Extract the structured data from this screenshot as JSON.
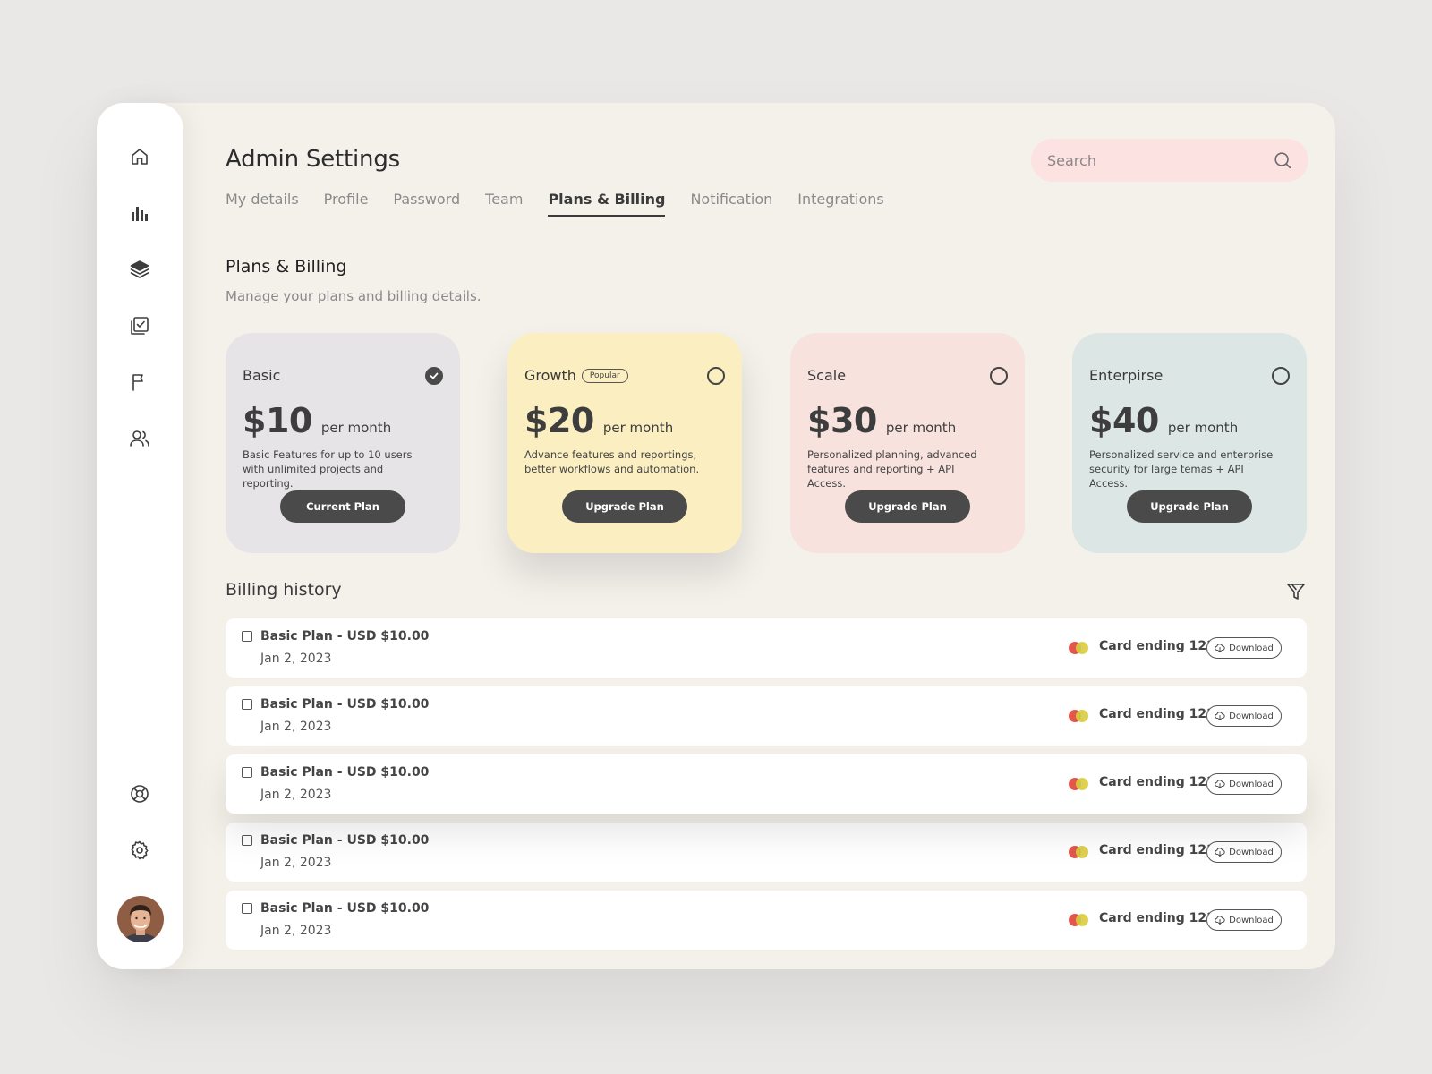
{
  "colors": {
    "background": "#e9e8e6",
    "panel": "#f4f1eb",
    "search_bg": "#fde2e2",
    "dark_button": "#4a4a4a",
    "plan_basic": "#e6e4e6",
    "plan_growth": "#fbeec0",
    "plan_scale": "#f7e2de",
    "plan_enterprise": "#dce6e5",
    "card_red": "#e2574c",
    "card_yellow": "#d8cc3f"
  },
  "sidebar": {
    "items": [
      {
        "icon": "home-icon"
      },
      {
        "icon": "bar-chart-icon"
      },
      {
        "icon": "layers-icon"
      },
      {
        "icon": "checklist-icon"
      },
      {
        "icon": "flag-icon"
      },
      {
        "icon": "users-icon"
      }
    ],
    "bottom_items": [
      {
        "icon": "support-icon"
      },
      {
        "icon": "gear-icon"
      }
    ]
  },
  "header": {
    "title": "Admin Settings",
    "search_placeholder": "Search"
  },
  "tabs": [
    {
      "label": "My details",
      "active": false
    },
    {
      "label": "Profile",
      "active": false
    },
    {
      "label": "Password",
      "active": false
    },
    {
      "label": "Team",
      "active": false
    },
    {
      "label": "Plans & Billing",
      "active": true
    },
    {
      "label": "Notification",
      "active": false
    },
    {
      "label": "Integrations",
      "active": false
    }
  ],
  "plans_section": {
    "title": "Plans & Billing",
    "subtitle": "Manage your plans and billing details."
  },
  "plans": [
    {
      "name": "Basic",
      "badge": "",
      "price": "$10",
      "period": "per month",
      "description": "Basic Features for up to 10 users with unlimited projects and reporting.",
      "button": "Current Plan",
      "selected": true
    },
    {
      "name": "Growth",
      "badge": "Popular",
      "price": "$20",
      "period": "per month",
      "description": "Advance features and reportings, better workflows and automation.",
      "button": "Upgrade Plan",
      "selected": false
    },
    {
      "name": "Scale",
      "badge": "",
      "price": "$30",
      "period": "per month",
      "description": "Personalized planning, advanced features and reporting + API Access.",
      "button": "Upgrade Plan",
      "selected": false
    },
    {
      "name": "Enterpirse",
      "badge": "",
      "price": "$40",
      "period": "per month",
      "description": "Personalized service and enterprise security for large temas + API Access.",
      "button": "Upgrade Plan",
      "selected": false
    }
  ],
  "billing": {
    "title": "Billing history",
    "rows": [
      {
        "title": "Basic Plan - USD $10.00",
        "date": "Jan 2, 2023",
        "card": "Card ending 1234",
        "action": "Download"
      },
      {
        "title": "Basic Plan - USD $10.00",
        "date": "Jan 2, 2023",
        "card": "Card ending 1234",
        "action": "Download"
      },
      {
        "title": "Basic Plan - USD $10.00",
        "date": "Jan 2, 2023",
        "card": "Card ending 1234",
        "action": "Download"
      },
      {
        "title": "Basic Plan - USD $10.00",
        "date": "Jan 2, 2023",
        "card": "Card ending 1234",
        "action": "Download"
      },
      {
        "title": "Basic Plan - USD $10.00",
        "date": "Jan 2, 2023",
        "card": "Card ending 1234",
        "action": "Download"
      }
    ]
  }
}
